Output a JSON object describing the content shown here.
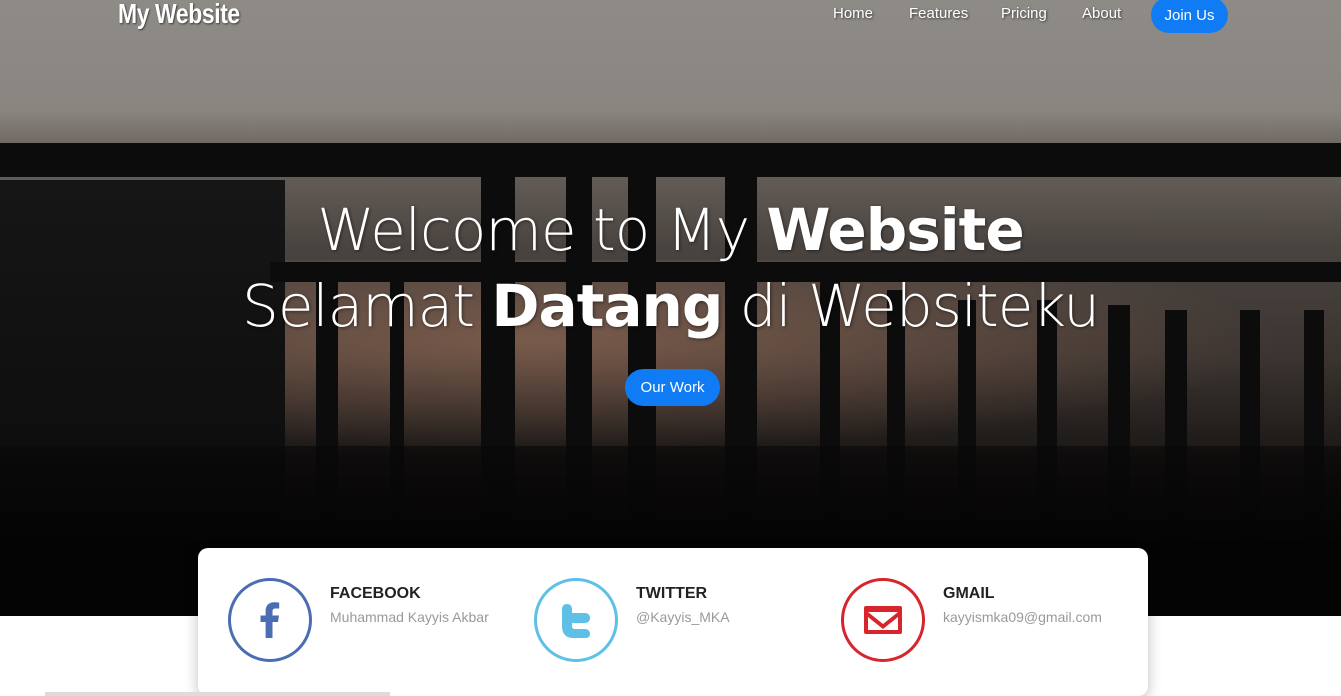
{
  "nav": {
    "brand": "My Website",
    "links": [
      {
        "label": "Home"
      },
      {
        "label": "Features"
      },
      {
        "label": "Pricing"
      },
      {
        "label": "About"
      }
    ],
    "join_label": "Join Us"
  },
  "hero": {
    "line1_a": "Welcome to My ",
    "line1_b": "Website",
    "line2_a": "Selamat ",
    "line2_b": "Datang",
    "line2_c": " di Websiteku",
    "button_label": "Our Work"
  },
  "social": [
    {
      "title": "FACEBOOK",
      "sub": "Muhammad Kayyis Akbar",
      "icon": "facebook-icon",
      "color": "#4a6db3"
    },
    {
      "title": "TWITTER",
      "sub": "@Kayyis_MKA",
      "icon": "twitter-icon",
      "color": "#5ec0e6"
    },
    {
      "title": "GMAIL",
      "sub": "kayyismka09@gmail.com",
      "icon": "gmail-icon",
      "color": "#d8252c"
    }
  ],
  "colors": {
    "accent": "#0f7cf6"
  }
}
